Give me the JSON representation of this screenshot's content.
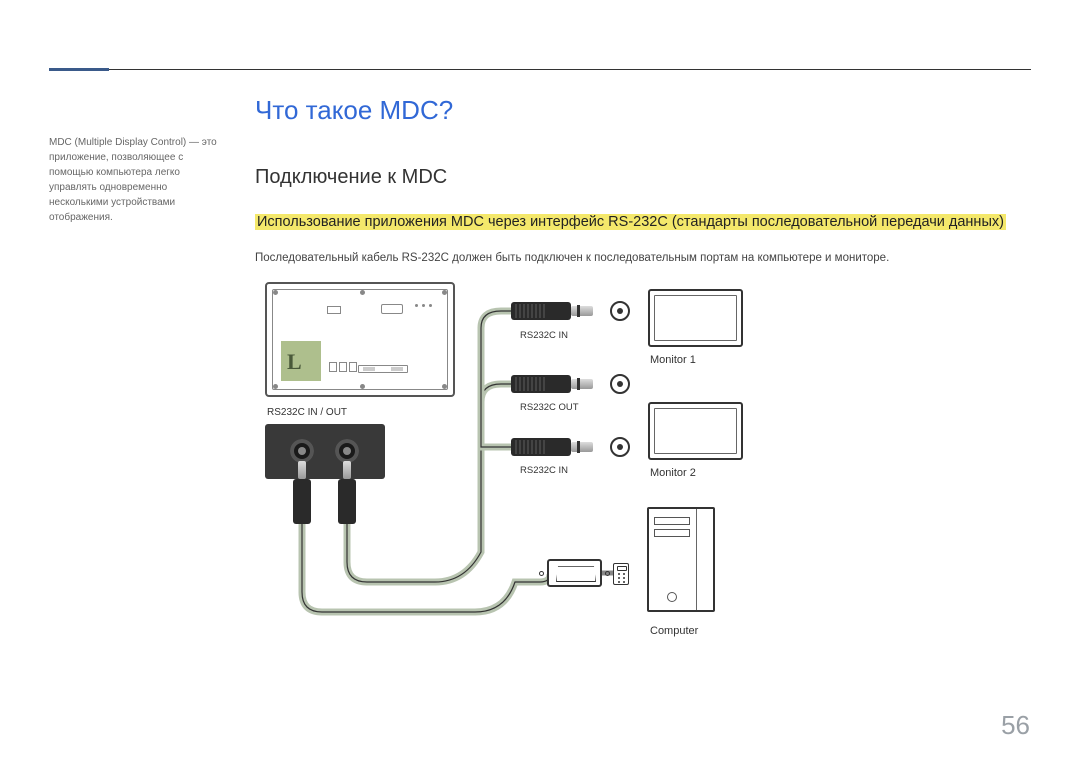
{
  "page_number": "56",
  "sidebar": {
    "note": "MDC (Multiple Display Control) — это приложение, позволяющее с помощью компьютера легко управлять одновременно несколькими устройствами отображения."
  },
  "content": {
    "title": "Что такое MDC?",
    "subtitle": "Подключение к MDC",
    "highlighted": "Использование приложения MDC через интерфейс RS-232C (стандарты последовательной передачи данных)",
    "body": "Последовательный кабель RS-232C должен быть подключен к последовательным портам на компьютере и мониторе."
  },
  "diagram": {
    "port_panel_label": "RS232C IN / OUT",
    "rs232c_in_1": "RS232C IN",
    "rs232c_out": "RS232C OUT",
    "rs232c_in_2": "RS232C IN",
    "monitor1": "Monitor 1",
    "monitor2": "Monitor 2",
    "computer": "Computer",
    "logo_letter": "L"
  }
}
